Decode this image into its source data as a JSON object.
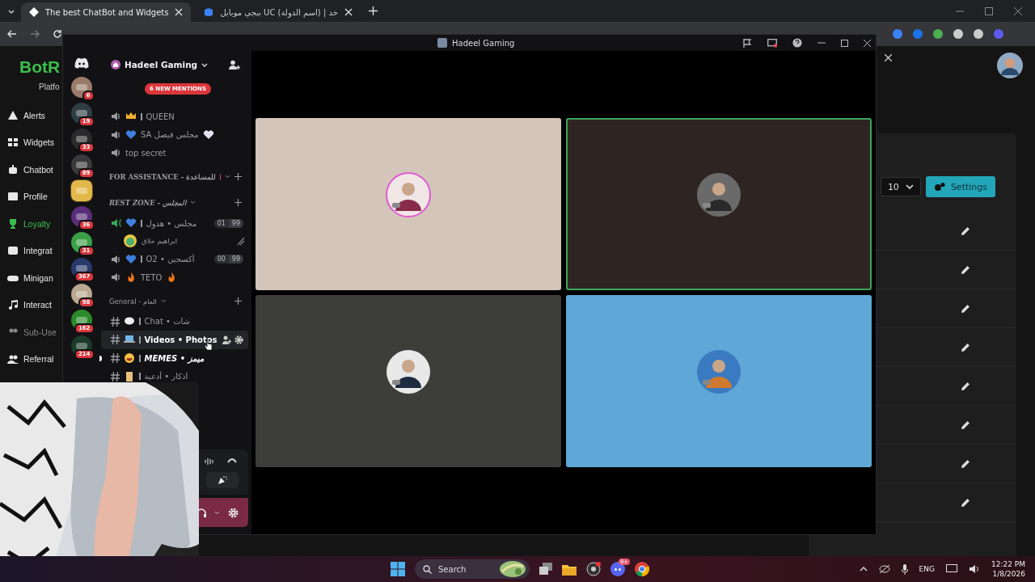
{
  "browser": {
    "tabs": [
      {
        "title": "The best ChatBot and Widgets",
        "selected": true
      },
      {
        "title": "ببجي موبايل UC (اسم الدولة) | خد",
        "selected": false
      }
    ]
  },
  "site": {
    "logo": "BotR",
    "section": "Platfo",
    "menu": [
      {
        "label": "Alerts",
        "selected": false
      },
      {
        "label": "Widgets",
        "selected": false
      },
      {
        "label": "Chatbot",
        "selected": false
      },
      {
        "label": "Profile",
        "selected": false
      },
      {
        "label": "Loyalty",
        "selected": true
      },
      {
        "label": "Integrat",
        "selected": false
      },
      {
        "label": "Minigan",
        "selected": false
      },
      {
        "label": "Interact",
        "selected": false
      },
      {
        "label": "Sub-Use",
        "selected": false
      },
      {
        "label": "Referral",
        "selected": false
      }
    ],
    "page_size": "10",
    "settings_button": "Settings",
    "rows": [
      {
        "kind": "editable"
      },
      {
        "kind": "editable"
      },
      {
        "kind": "editable"
      },
      {
        "kind": "editable"
      },
      {
        "kind": "editable"
      },
      {
        "kind": "editable"
      },
      {
        "kind": "editable"
      },
      {
        "kind": "editable"
      }
    ]
  },
  "discord": {
    "window_title": "Hadeel Gaming",
    "server_name": "Hadeel Gaming",
    "mentions_badge": "6 NEW MENTIONS",
    "servers": [
      {
        "badge": "6"
      },
      {
        "badge": "19"
      },
      {
        "badge": "33"
      },
      {
        "badge": "89"
      },
      {
        "kind": "plain"
      },
      {
        "badge": "36"
      },
      {
        "badge": "31"
      },
      {
        "badge": "367"
      },
      {
        "badge": "98"
      },
      {
        "badge": "162"
      },
      {
        "badge": "214"
      }
    ],
    "channels": [
      {
        "kind": "voice",
        "name": "QUEEN",
        "active": false
      },
      {
        "kind": "voice",
        "name": "مجلس فيصل SA",
        "active": false
      },
      {
        "kind": "voice",
        "name": "top secret",
        "active": false
      },
      {
        "kind": "category",
        "name": "FOR ASSISTANCE - للمساعدة",
        "color": "#e0457b",
        "italic": false
      },
      {
        "kind": "category",
        "name": "REST ZONE - المجلس",
        "italic": true
      },
      {
        "kind": "voice",
        "name": "مجلس • هدول",
        "active": true,
        "count": "01",
        "limit": "99"
      },
      {
        "kind": "user",
        "name": "ابراهيم حلاق"
      },
      {
        "kind": "voice",
        "name": "O2 • أكسجين",
        "active": false,
        "count": "00",
        "limit": "99"
      },
      {
        "kind": "voice",
        "name": "TETO",
        "active": false
      },
      {
        "kind": "category",
        "name": "General - العام",
        "italic": false
      },
      {
        "kind": "text",
        "name": "Chat • شات",
        "selected": false,
        "unread": false
      },
      {
        "kind": "text",
        "name": "Videos • Photos",
        "selected": true,
        "unread": false
      },
      {
        "kind": "text",
        "name": "MEMES • ميمز",
        "selected": false,
        "unread": true
      },
      {
        "kind": "text",
        "name": "اذكار • أدعية",
        "selected": false,
        "unread": false
      }
    ],
    "tiles": [
      {
        "color": "#d3c5ba",
        "speaking": false
      },
      {
        "color": "#2e2523",
        "speaking": true
      },
      {
        "color": "#3d3e39",
        "speaking": false
      },
      {
        "color": "#5ea7d6",
        "speaking": false
      }
    ]
  },
  "taskbar": {
    "search": "Search",
    "discord_badge": "9+",
    "language": "ENG",
    "time": "12:22 PM",
    "date": "1/8/2026"
  }
}
